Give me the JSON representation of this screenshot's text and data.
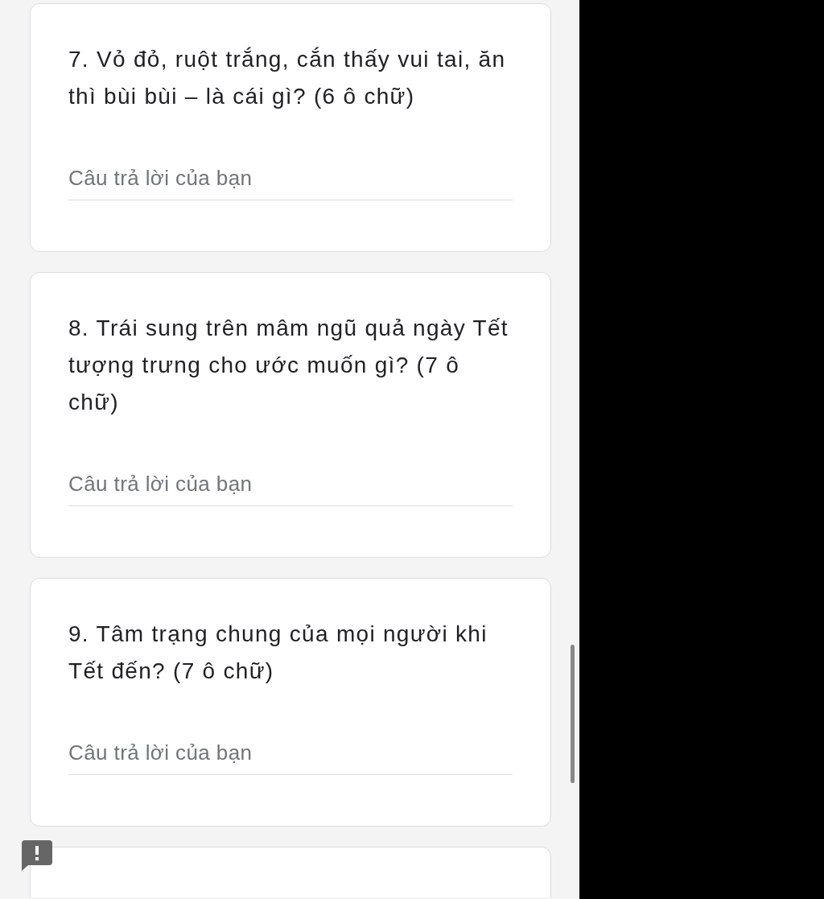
{
  "cards": [
    {
      "kind": "question",
      "question": "7. Vỏ đỏ, ruột trắng, cắn thấy vui tai, ăn thì bùi bùi – là cái gì? (6 ô chữ)",
      "answer": {
        "placeholder": "Câu trả lời của bạn"
      }
    },
    {
      "kind": "question",
      "question": "8. Trái sung trên mâm ngũ quả ngày Tết tượng trưng cho ước muốn gì? (7 ô chữ)",
      "answer": {
        "placeholder": "Câu trả lời của bạn"
      }
    },
    {
      "kind": "question",
      "question": "9. Tâm trạng chung của mọi người khi Tết đến? (7 ô chữ)",
      "answer": {
        "placeholder": "Câu trả lời của bạn"
      }
    },
    {
      "kind": "clipped"
    }
  ]
}
